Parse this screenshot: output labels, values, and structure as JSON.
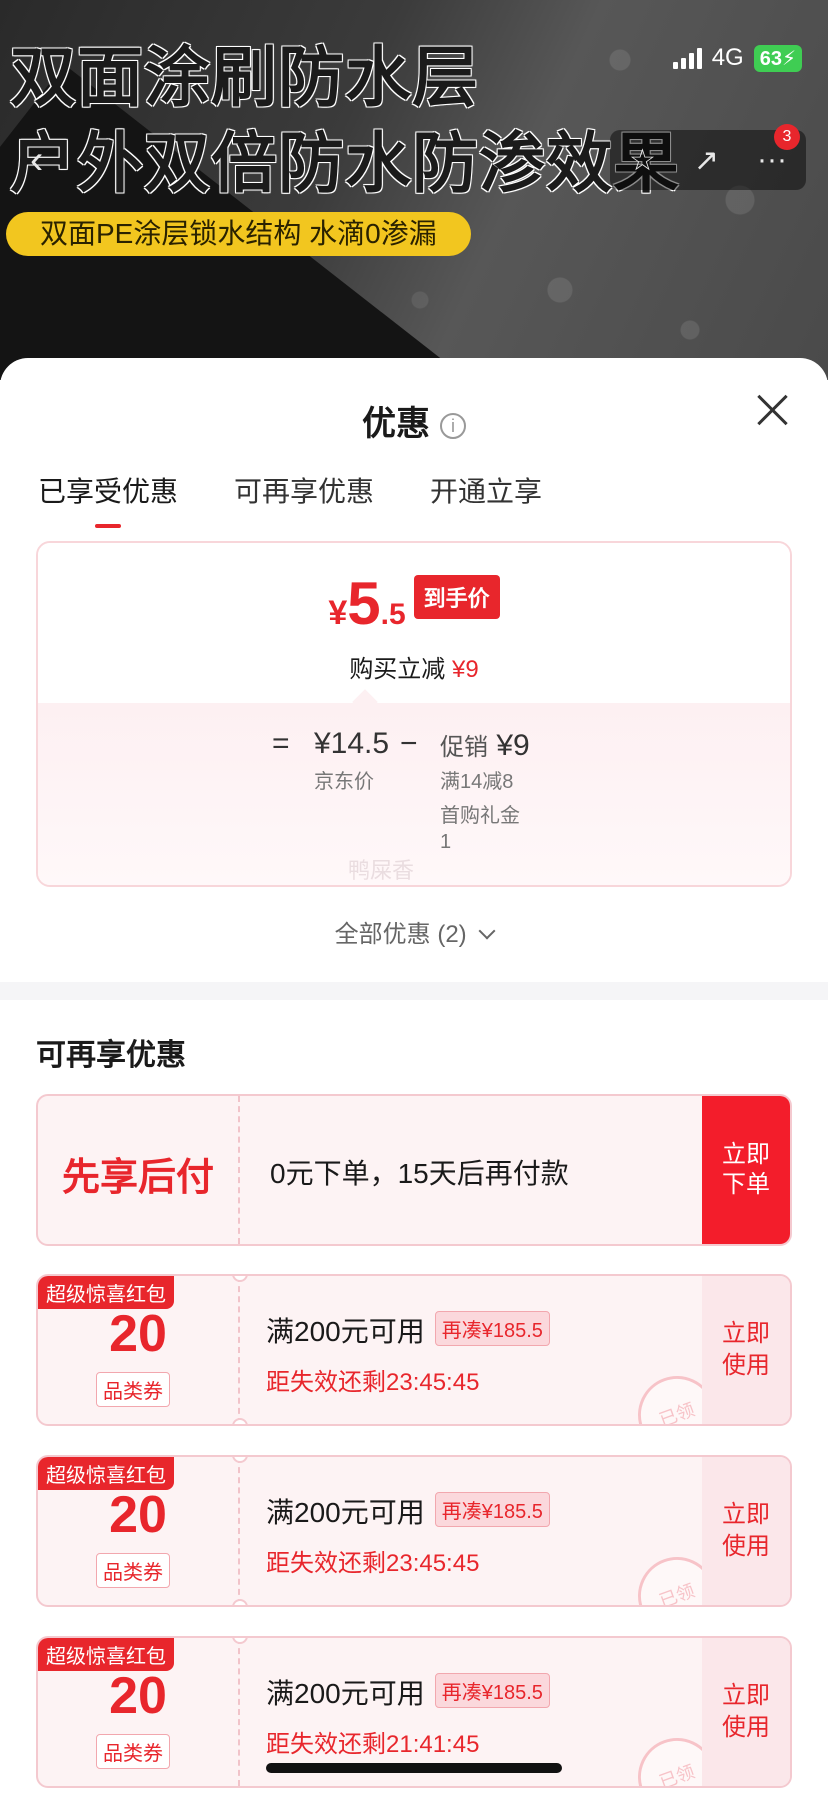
{
  "hero": {
    "line1": "双面涂刷防水层",
    "line2": "户外双倍防水防渗效果",
    "tagline": "双面PE涂层锁水结构 水滴0渗漏"
  },
  "status_bar": {
    "network": "4G",
    "battery": "63"
  },
  "top_nav": {
    "cart_badge": "3",
    "icons": [
      "back-icon",
      "star-icon",
      "share-icon",
      "more-icon"
    ]
  },
  "sheet": {
    "title": "优惠",
    "tabs": [
      {
        "label": "已享受优惠",
        "active": true
      },
      {
        "label": "可再享优惠",
        "active": false
      },
      {
        "label": "开通立享",
        "active": false
      }
    ],
    "price_card": {
      "currency": "¥",
      "price_int": "5",
      "price_dec": ".5",
      "price_tag": "到手价",
      "saving_label": "购买立减",
      "saving_value": "¥9",
      "calc": {
        "equals": "=",
        "jd_price": "¥14.5",
        "jd_price_label": "京东价",
        "minus": "−",
        "promo_label": "促销",
        "promo_value": "¥9",
        "promo_rule": "满14减8",
        "first_gift_line1": "首购礼金",
        "first_gift_line2": "1"
      },
      "watermark": "鸭屎香"
    },
    "all_offers": "全部优惠 (2)",
    "section_title": "可再享优惠",
    "bnpl": {
      "title": "先享后付",
      "desc": "0元下单，15天后再付款",
      "action_line1": "立即",
      "action_line2": "下单"
    },
    "coupons": [
      {
        "flag": "超级惊喜红包",
        "amount": "20",
        "type": "品类券",
        "condition": "满200元可用",
        "need": "再凑¥185.5",
        "timer": "距失效还剩23:45:45",
        "action_line1": "立即",
        "action_line2": "使用",
        "stamp": "已领"
      },
      {
        "flag": "超级惊喜红包",
        "amount": "20",
        "type": "品类券",
        "condition": "满200元可用",
        "need": "再凑¥185.5",
        "timer": "距失效还剩23:45:45",
        "action_line1": "立即",
        "action_line2": "使用",
        "stamp": "已领"
      },
      {
        "flag": "超级惊喜红包",
        "amount": "20",
        "type": "品类券",
        "condition": "满200元可用",
        "need": "再凑¥185.5",
        "timer": "距失效还剩21:41:45",
        "action_line1": "立即",
        "action_line2": "使用",
        "stamp": "已领"
      }
    ]
  },
  "colors": {
    "accent": "#e8262c",
    "tag_yellow": "#f2c61f",
    "battery_green": "#3fcd53"
  }
}
